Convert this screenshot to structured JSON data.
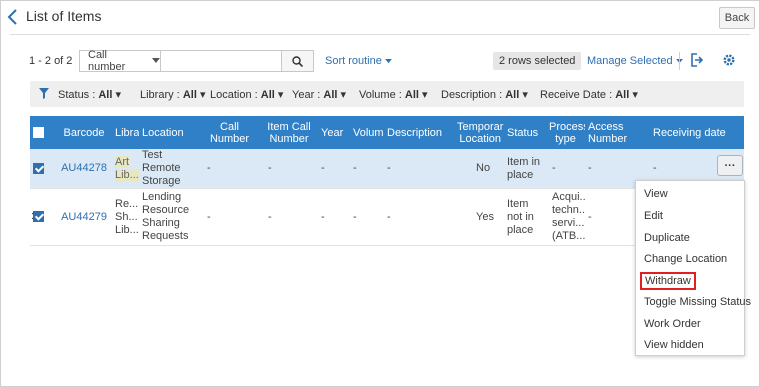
{
  "header": {
    "title": "List of Items",
    "back_label": "Back"
  },
  "toolbar": {
    "count_text": "1 - 2 of 2",
    "search_field_select": "Call number",
    "search_value": "",
    "sort_label": "Sort routine",
    "rows_selected": "2 rows selected",
    "manage_label": "Manage Selected"
  },
  "filters": {
    "status": {
      "label": "Status :",
      "value": "All"
    },
    "library": {
      "label": "Library :",
      "value": "All"
    },
    "location": {
      "label": "Location :",
      "value": "All"
    },
    "year": {
      "label": "Year :",
      "value": "All"
    },
    "volume": {
      "label": "Volume :",
      "value": "All"
    },
    "description": {
      "label": "Description :",
      "value": "All"
    },
    "receive_date": {
      "label": "Receive Date :",
      "value": "All"
    }
  },
  "table": {
    "columns": [
      "Barcode",
      "Libra",
      "Location",
      "Call Number",
      "Item Call Number",
      "Year",
      "Volum",
      "Description",
      "Temporar Location",
      "Status",
      "Process type",
      "Access Number",
      "Receiving date"
    ],
    "rows": [
      {
        "selected": true,
        "barcode": "AU44278",
        "library": "Art Lib...",
        "location": "Test Remote Storage",
        "call_number": "-",
        "item_call_number": "-",
        "year": "-",
        "volume": "-",
        "description": "-",
        "temporary_location": "No",
        "status": "Item in place",
        "process_type": "-",
        "access_number": "-",
        "receiving_date": "-"
      },
      {
        "selected": true,
        "barcode": "AU44279",
        "library": "Re... Sh... Lib...",
        "location": "Lending Resource Sharing Requests",
        "call_number": "-",
        "item_call_number": "-",
        "year": "-",
        "volume": "-",
        "description": "-",
        "temporary_location": "Yes",
        "status": "Item not in place",
        "process_type": "Acqui... techn... servi... (ATB...",
        "access_number": "-",
        "receiving_date": ""
      }
    ],
    "more_label": "···",
    "row2_prefix": ":"
  },
  "row_menu": {
    "items": [
      "View",
      "Edit",
      "Duplicate",
      "Change Location",
      "Withdraw",
      "Toggle Missing Status",
      "Work Order",
      "View hidden"
    ],
    "highlighted": "Withdraw",
    "highlight_color": "#e02020"
  },
  "colors": {
    "header_blue": "#2f80c7",
    "link_blue": "#2d6fb0",
    "selected_row": "#dbe9f6"
  }
}
